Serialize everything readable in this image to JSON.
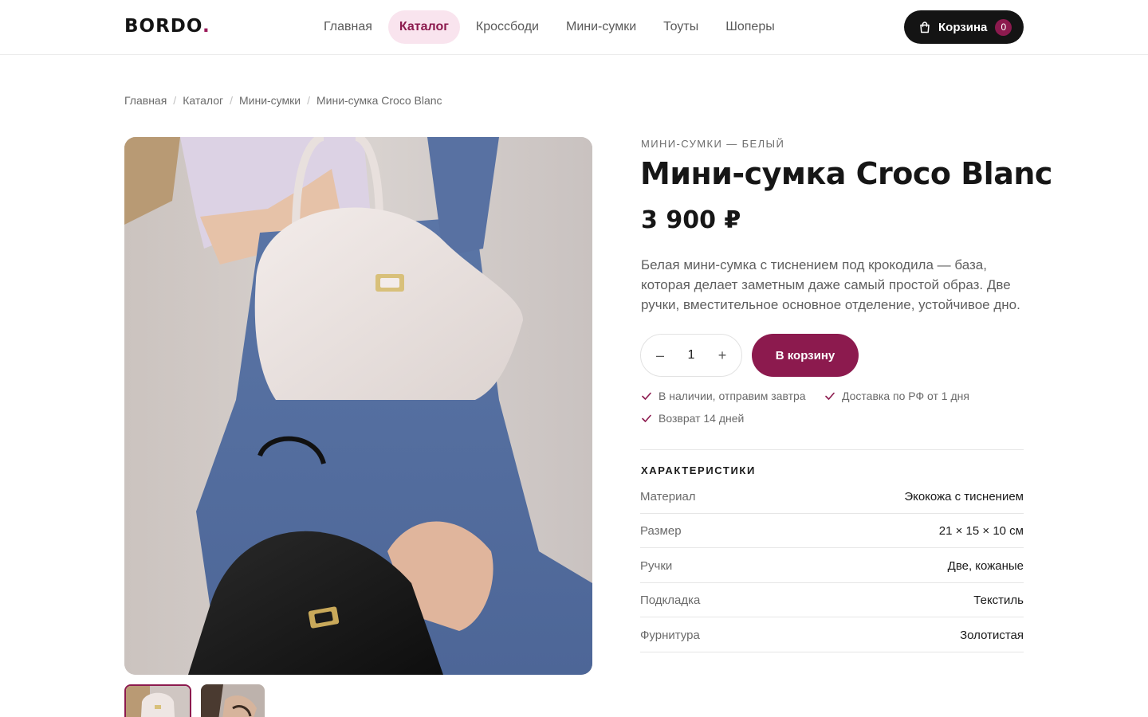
{
  "header": {
    "logo": "BORDO",
    "logo_dot": ".",
    "nav": [
      {
        "label": "Главная",
        "active": false
      },
      {
        "label": "Каталог",
        "active": true
      },
      {
        "label": "Кроссбоди",
        "active": false
      },
      {
        "label": "Мини-сумки",
        "active": false
      },
      {
        "label": "Тоуты",
        "active": false
      },
      {
        "label": "Шоперы",
        "active": false
      }
    ],
    "cart_label": "Корзина",
    "cart_count": "0"
  },
  "breadcrumb": [
    "Главная",
    "Каталог",
    "Мини-сумки",
    "Мини-сумка Croco Blanc"
  ],
  "product": {
    "category": "МИНИ-СУМКИ — БЕЛЫЙ",
    "title": "Мини-сумка Croco Blanc",
    "price": "3 900 ₽",
    "description": "Белая мини-сумка с тиснением под крокодила — база, которая делает заметным даже самый простой образ. Две ручки, вместительное основное отделение, устойчивое дно.",
    "quantity": "1",
    "qty_minus": "–",
    "qty_plus": "+",
    "add_to_cart": "В корзину",
    "perks": [
      "В наличии, отправим завтра",
      "Доставка по РФ от 1 дня",
      "Возврат 14 дней"
    ]
  },
  "specs": {
    "title": "ХАРАКТЕРИСТИКИ",
    "rows": [
      {
        "key": "Материал",
        "value": "Экокожа с тиснением"
      },
      {
        "key": "Размер",
        "value": "21 × 15 × 10 см"
      },
      {
        "key": "Ручки",
        "value": "Две, кожаные"
      },
      {
        "key": "Подкладка",
        "value": "Текстиль"
      },
      {
        "key": "Фурнитура",
        "value": "Золотистая"
      }
    ]
  },
  "colors": {
    "accent": "#8c1a4e",
    "accent_light": "#f9e4ee",
    "dark": "#141414"
  },
  "icons": {
    "cart": "shopping-bag-icon",
    "perk": "check-icon"
  }
}
